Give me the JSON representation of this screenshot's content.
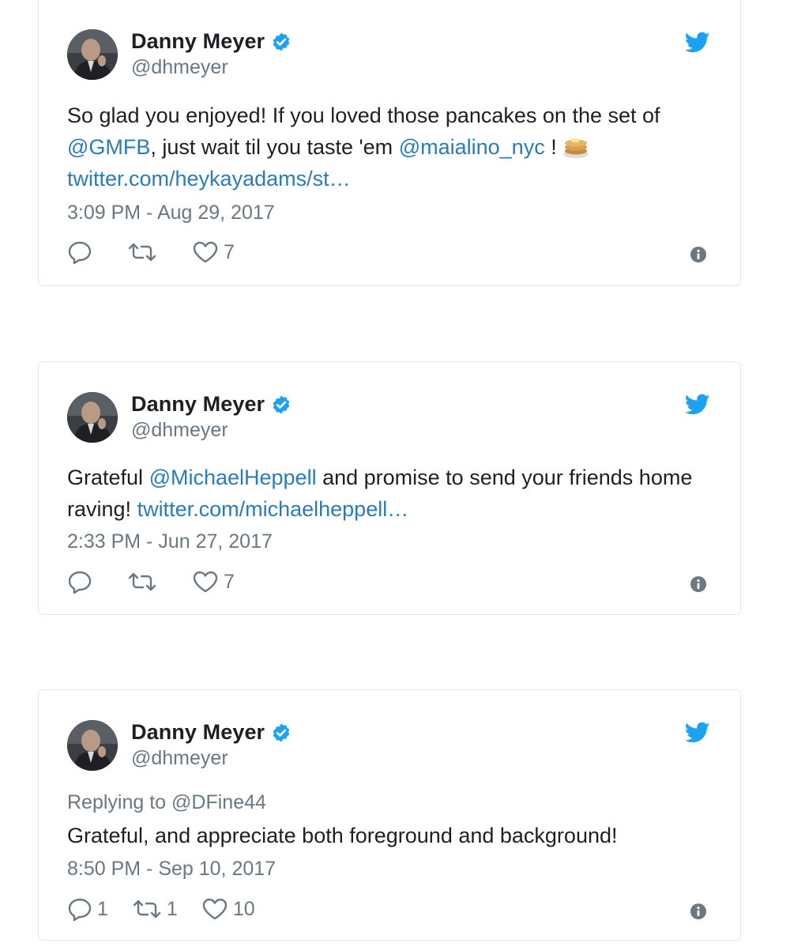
{
  "colors": {
    "link": "#2b7bb9",
    "muted": "#697882",
    "twitter_blue": "#1da1f2",
    "border": "#e1e8ed"
  },
  "tweets": [
    {
      "name": "Danny Meyer",
      "handle": "@dhmeyer",
      "text_parts": {
        "p1": "So glad you enjoyed! If you loved those pancakes on the set of",
        "m1": "@GMFB",
        "p2": ", just wait til you taste 'em",
        "m2": "@maialino_nyc",
        "p3": " !",
        "link": "twitter.com/heykayadams/st…"
      },
      "timestamp": "3:09 PM - Aug 29, 2017",
      "reply_count": "",
      "retweet_count": "",
      "like_count": "7"
    },
    {
      "name": "Danny Meyer",
      "handle": "@dhmeyer",
      "text_parts": {
        "p1": "Grateful",
        "m1": "@MichaelHeppell",
        "p2": "and promise to send your friends home raving!",
        "link": "twitter.com/michaelheppell…"
      },
      "timestamp": "2:33 PM - Jun 27, 2017",
      "reply_count": "",
      "retweet_count": "",
      "like_count": "7"
    },
    {
      "name": "Danny Meyer",
      "handle": "@dhmeyer",
      "replying_prefix": "Replying to",
      "replying_to": "@DFine44",
      "text": "Grateful, and appreciate both foreground and background!",
      "timestamp": "8:50 PM - Sep 10, 2017",
      "reply_count": "1",
      "retweet_count": "1",
      "like_count": "10"
    }
  ],
  "icons": [
    "verified-badge-icon",
    "twitter-bird-icon",
    "reply-icon",
    "retweet-icon",
    "like-icon",
    "info-icon",
    "pancakes-emoji"
  ]
}
